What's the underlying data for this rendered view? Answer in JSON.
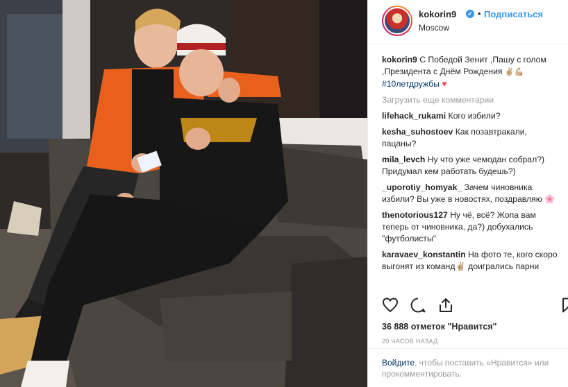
{
  "post": {
    "photo_alt": "",
    "header": {
      "username": "kokorin9",
      "verified_mark": "✔",
      "separator": "•",
      "follow_label": "Подписаться",
      "location": "Moscow",
      "avatar_icon": "profile-avatar"
    },
    "caption": {
      "username": "kokorin9",
      "text": "С Победой Зенит ,Пашу с голом ,Президента с Днём Рождения",
      "emoji": "✌🏼💪🏼",
      "hashtag": "#10летдружбы",
      "heart": "♥"
    },
    "load_more_label": "Загрузить еще комментарии",
    "comments": [
      {
        "user": "lifehack_rukami",
        "text": "Кого избили?"
      },
      {
        "user": "kesha_suhostoev",
        "text": "Как позавтракали, пацаны?"
      },
      {
        "user": "mila_levch",
        "text": "Ну что уже чемодан собрал?) Придумал кем работать будешь?)"
      },
      {
        "user": "_uporotiy_homyak_",
        "text": "Зачем чиновника избили? Вы уже в новостях, поздравляю 🌸"
      },
      {
        "user": "thenotorious127",
        "text": "Ну чё, всё? Жопа вам теперь от чиновника, да?) добухались \"футболисты\""
      },
      {
        "user": "karavaev_konstantin",
        "text": "На фото те, кого скоро выгонят из команд✌🏼 доигрались парни"
      }
    ],
    "actions": {
      "like_icon": "heart-outline-icon",
      "comment_icon": "comment-bubble-icon",
      "share_icon": "share-upload-icon",
      "save_icon": "bookmark-icon"
    },
    "likes_text": "36 888 отметок \"Нравится\"",
    "time_text": "20 ЧАСОВ НАЗАД",
    "login": {
      "link_label": "Войдите",
      "rest_text": ", чтобы поставить «Нравится» или прокомментировать."
    },
    "colors": {
      "accent": "#3897f0",
      "link_dark": "#003569",
      "muted": "#999999",
      "heart_red": "#ed4956"
    }
  }
}
